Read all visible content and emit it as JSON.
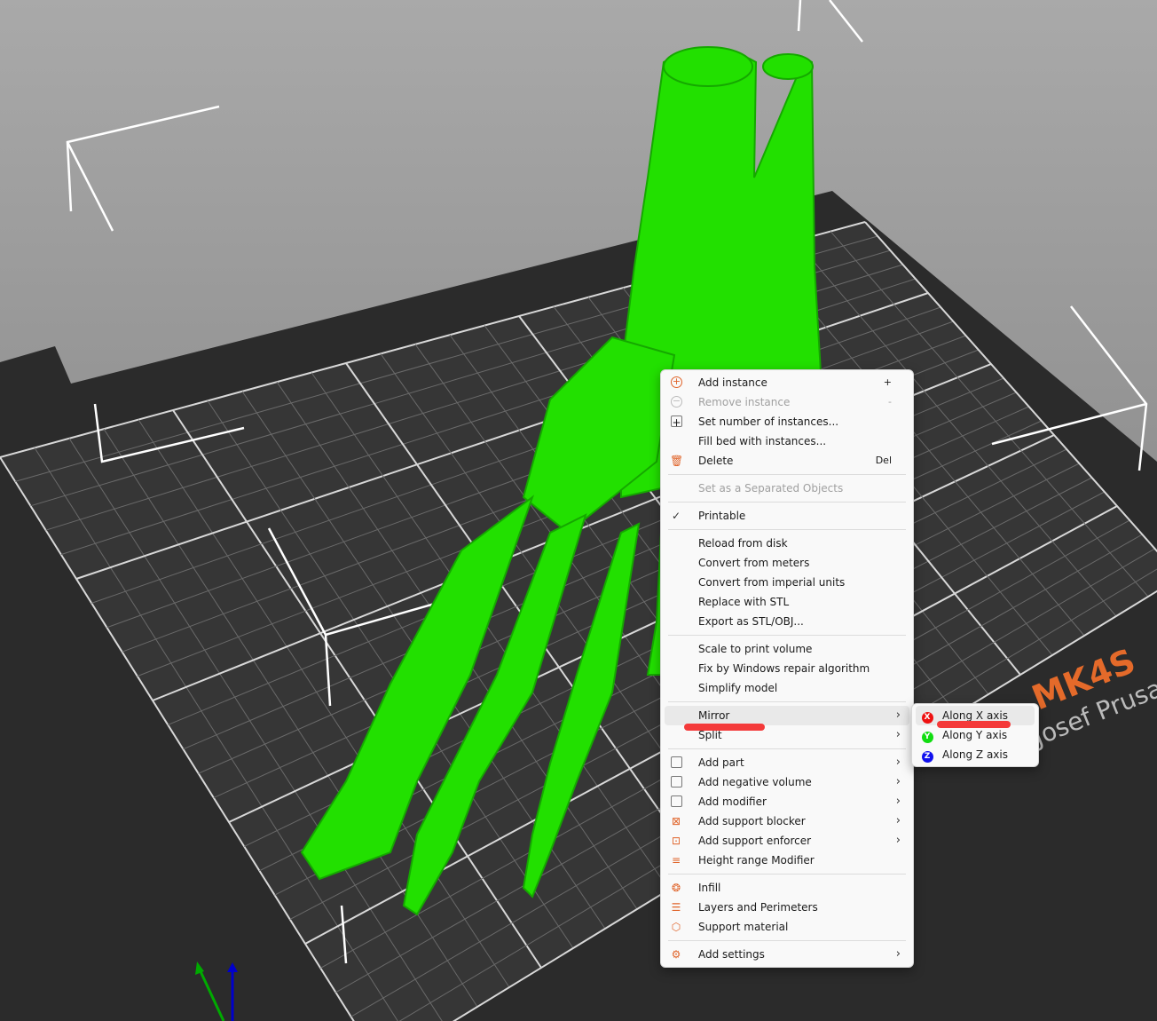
{
  "viewport": {
    "model_color": "#22e000",
    "bed_color": "#2b2b2b",
    "bed_label": "MK4S",
    "bed_sublabel": "Josef Prusa"
  },
  "context_menu": {
    "groups": [
      [
        {
          "label": "Add instance",
          "shortcut": "+",
          "icon": "add-circle-icon"
        },
        {
          "label": "Remove instance",
          "shortcut": "-",
          "icon": "remove-circle-icon",
          "disabled": true
        },
        {
          "label": "Set number of instances...",
          "icon": "instances-icon"
        },
        {
          "label": "Fill bed with instances..."
        },
        {
          "label": "Delete",
          "shortcut": "Del",
          "icon": "trash-icon"
        }
      ],
      [
        {
          "label": "Set as a Separated Objects",
          "disabled": true
        }
      ],
      [
        {
          "label": "Printable",
          "icon": "check-icon"
        }
      ],
      [
        {
          "label": "Reload from disk"
        },
        {
          "label": "Convert from meters"
        },
        {
          "label": "Convert from imperial units"
        },
        {
          "label": "Replace with STL"
        },
        {
          "label": "Export as STL/OBJ..."
        }
      ],
      [
        {
          "label": "Scale to print volume"
        },
        {
          "label": "Fix by Windows repair algorithm"
        },
        {
          "label": "Simplify model"
        }
      ],
      [
        {
          "label": "Mirror",
          "submenu": true,
          "highlighted": true
        },
        {
          "label": "Split",
          "submenu": true
        }
      ],
      [
        {
          "label": "Add part",
          "submenu": true,
          "icon": "add-part-icon"
        },
        {
          "label": "Add negative volume",
          "submenu": true,
          "icon": "negative-volume-icon"
        },
        {
          "label": "Add modifier",
          "submenu": true,
          "icon": "modifier-icon"
        },
        {
          "label": "Add support blocker",
          "submenu": true,
          "icon": "support-blocker-icon"
        },
        {
          "label": "Add support enforcer",
          "submenu": true,
          "icon": "support-enforcer-icon"
        },
        {
          "label": "Height range Modifier",
          "icon": "height-range-icon"
        }
      ],
      [
        {
          "label": "Infill",
          "icon": "infill-icon"
        },
        {
          "label": "Layers and Perimeters",
          "icon": "layers-icon"
        },
        {
          "label": "Support material",
          "icon": "support-material-icon"
        }
      ],
      [
        {
          "label": "Add settings",
          "submenu": true,
          "icon": "gear-icon"
        }
      ]
    ]
  },
  "mirror_submenu": [
    {
      "label": "Along X axis",
      "badge": "X",
      "color": "#ee1111",
      "highlighted": true
    },
    {
      "label": "Along Y axis",
      "badge": "Y",
      "color": "#11dd11"
    },
    {
      "label": "Along Z axis",
      "badge": "Z",
      "color": "#1111ee"
    }
  ]
}
